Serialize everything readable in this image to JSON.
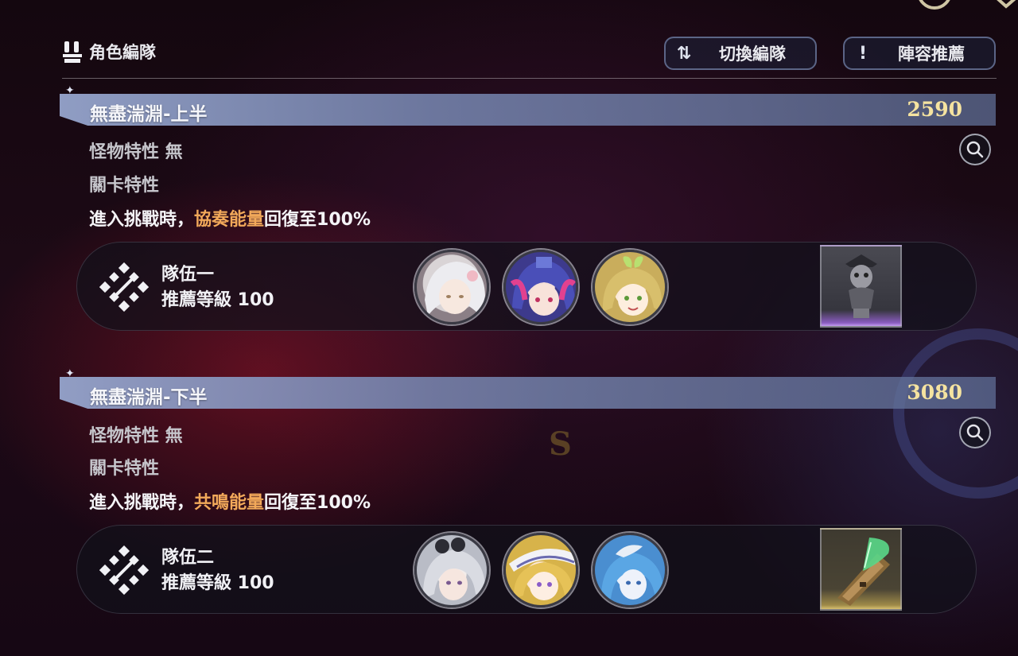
{
  "header": {
    "title": "角色編隊",
    "switch_label": "切換編隊",
    "recommend_label": "陣容推薦"
  },
  "sections": [
    {
      "name": "無盡湍淵-上半",
      "score": "2590",
      "monster_trait": "怪物特性 無",
      "stage_trait": "關卡特性",
      "effect_prefix": "進入挑戰時，",
      "effect_highlight": "協奏能量",
      "effect_suffix": "回復至100%",
      "team": {
        "name": "隊伍一",
        "level_label": "推薦等級 100",
        "item_icon": "pirate-skull-bust-icon",
        "item_accent": "#a070d8"
      },
      "characters": [
        "white-hair-character-avatar",
        "blue-pink-hair-character-avatar",
        "blonde-leaf-character-avatar"
      ]
    },
    {
      "name": "無盡湍淵-下半",
      "score": "3080",
      "monster_trait": "怪物特性 無",
      "stage_trait": "關卡特性",
      "effect_prefix": "進入挑戰時，",
      "effect_highlight": "共鳴能量",
      "effect_suffix": "回復至100%",
      "team": {
        "name": "隊伍二",
        "level_label": "推薦等級 100",
        "item_icon": "glowing-feather-quill-icon",
        "item_accent": "#d8c070"
      },
      "characters": [
        "silver-hair-goggles-character-avatar",
        "blonde-white-hat-character-avatar",
        "blue-hair-character-avatar"
      ]
    }
  ],
  "colors": {
    "highlight": "#f2a95a",
    "score": "#f5e3a0",
    "section_bar": "#8c9bc8"
  }
}
